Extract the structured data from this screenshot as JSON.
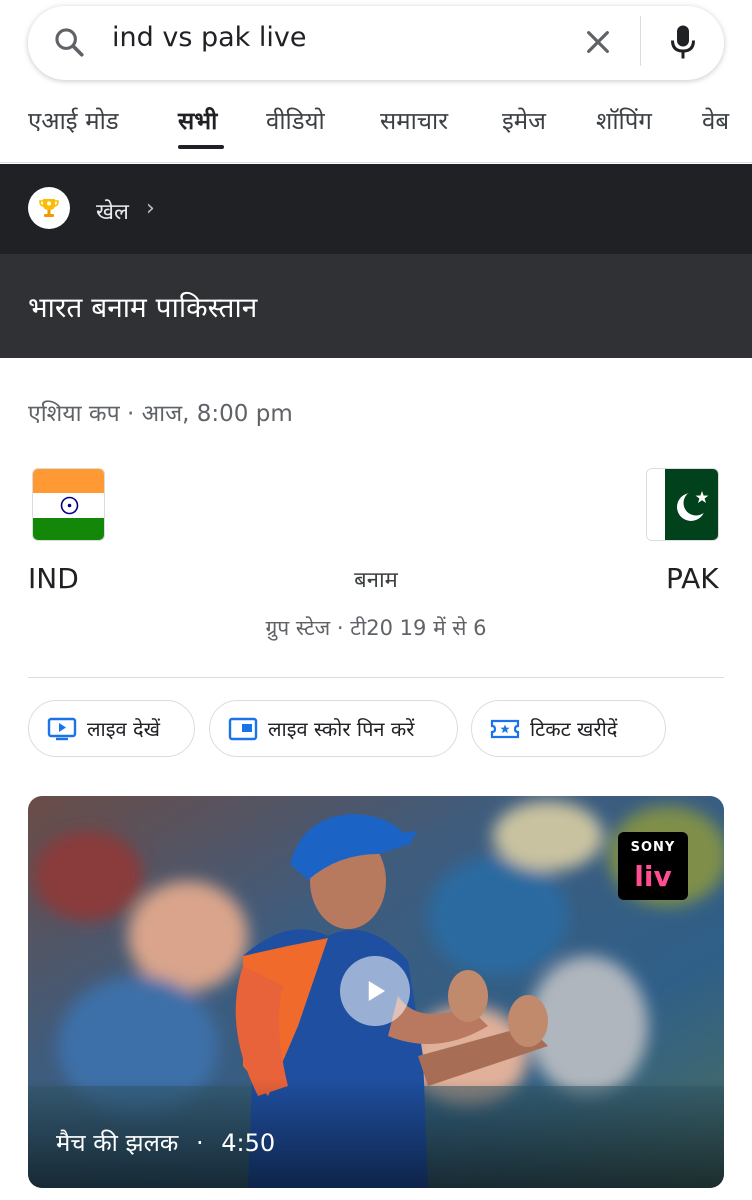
{
  "search": {
    "query": "ind vs pak live"
  },
  "tabs": [
    {
      "label": "एआई मोड"
    },
    {
      "label": "सभी"
    },
    {
      "label": "वीडियो"
    },
    {
      "label": "समाचार"
    },
    {
      "label": "इमेज"
    },
    {
      "label": "शॉपिंग"
    },
    {
      "label": "वेब"
    }
  ],
  "active_tab": "सभी",
  "sports_header": {
    "label": "खेल",
    "chevron": "›",
    "icon": "trophy-icon"
  },
  "match": {
    "title": "भारत बनाम पाकिस्तान",
    "meta": "एशिया कप · आज, 8:00 pm",
    "team1": "IND",
    "team2": "PAK",
    "vs": "बनाम",
    "stage": "ग्रुप स्टेज · टी20 19 में से 6"
  },
  "actions": [
    {
      "label": "लाइव देखें",
      "icon": "live-tv-icon"
    },
    {
      "label": "लाइव स्कोर पिन करें",
      "icon": "pin-score-icon"
    },
    {
      "label": "टिकट खरीदें",
      "icon": "ticket-icon"
    }
  ],
  "video": {
    "brand_top": "SONY",
    "brand_bottom": "liv",
    "caption_title": "मैच की झलक",
    "caption_sep": "·",
    "duration": "4:50"
  },
  "colors": {
    "accent_blue": "#1a73e8",
    "dark_bar": "#202124",
    "title_bar": "#303134"
  }
}
